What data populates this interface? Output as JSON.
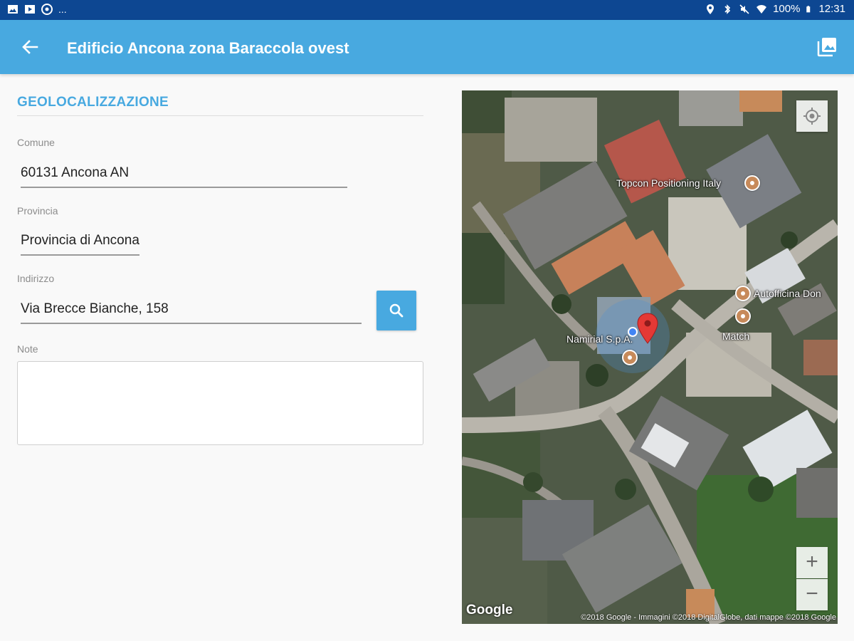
{
  "status_bar": {
    "left_icons": [
      "image-icon",
      "media-icon",
      "chrome-icon"
    ],
    "overflow": "...",
    "battery": "100%",
    "time": "12:31"
  },
  "app_bar": {
    "title": "Edificio Ancona zona Baraccola ovest",
    "back_icon": "arrow-back-icon",
    "action_icon": "photo-library-icon"
  },
  "form": {
    "section_title": "GEOLOCALIZZAZIONE",
    "comune": {
      "label": "Comune",
      "value": "60131 Ancona AN"
    },
    "provincia": {
      "label": "Provincia",
      "value": "Provincia di Ancona"
    },
    "indirizzo": {
      "label": "Indirizzo",
      "value": "Via Brecce Bianche, 158"
    },
    "note": {
      "label": "Note",
      "value": ""
    }
  },
  "map": {
    "places": [
      "Topcon Positioning Italy",
      "Autofficina Don",
      "Match",
      "Namirial S.p.A."
    ],
    "logo": "Google",
    "attribution": "©2018 Google - Immagini ©2018 DigitalGlobe, dati mappe ©2018 Google",
    "zoom_in": "+",
    "zoom_out": "−",
    "colors": {
      "marker": "#e53935",
      "my_location": "#4285f4",
      "poi": "#c78a5a"
    }
  },
  "colors": {
    "status_bar": "#0d4792",
    "app_bar": "#48a9e0",
    "accent": "#48a9e0"
  }
}
